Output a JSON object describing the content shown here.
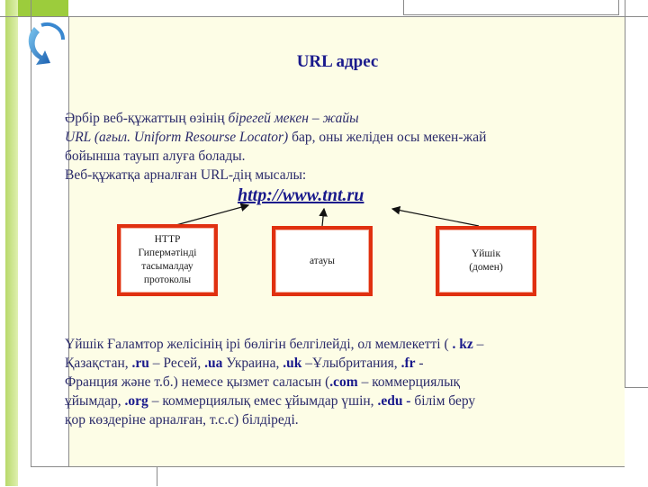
{
  "title": "URL адрес",
  "intro": {
    "line1_plain": "Әрбір веб-құжаттың өзінің ",
    "line1_italic": "бірегей мекен – жайы",
    "line2_italic": "URL (ағыл. Uniform Resourse Locator) ",
    "line2_plain": "бар, оны желіден осы мекен-жай",
    "line3": "бойынша тауып алуға болады.",
    "line4": "Веб-құжатқа  арналған URL-дің   мысалы:"
  },
  "url_example": "http://www.tnt.ru",
  "boxes": [
    {
      "lines": [
        "HTTP",
        "Гипермәтінді",
        "тасымалдау",
        "протоколы"
      ]
    },
    {
      "lines": [
        "атауы"
      ]
    },
    {
      "lines": [
        "Үйшік",
        "(домен)"
      ]
    }
  ],
  "domains": {
    "t1": "Үйшік Ғаламтор желісінің ірі бөлігін белгілейді, ол мемлекетті ( ",
    "kz": ". kz",
    "t2": " –",
    "t3": "Қазақстан, ",
    "ru": ".ru",
    "t4": " – Ресей, ",
    "ua": ".ua",
    "t5": " Украина, ",
    "uk": ".uk",
    "t6": " –Ұлыбритания, ",
    "fr": ".fr",
    "t7": " -",
    "t8": "Франция және т.б.) немесе қызмет саласын (",
    "com": ".com",
    "t9": " – коммерциялық",
    "t10": "ұйымдар, ",
    "org": ".org",
    "t11": " – коммерциялық емес ұйымдар үшін, ",
    "edu": ".edu -",
    "t12": " білім беру",
    "t13": "қор көздеріне арналған, т.с.с) білдіреді."
  },
  "colors": {
    "accent_red": "#e03010",
    "text_blue": "#1a1a8c",
    "slide_bg": "#fdfde6",
    "green": "#9ccc3c"
  }
}
